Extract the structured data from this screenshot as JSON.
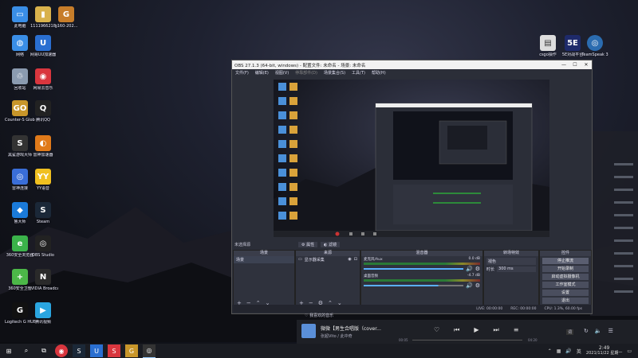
{
  "desktop_icons": [
    {
      "label": "此电脑",
      "icon": "computer-icon",
      "color": "#3a8ee6",
      "glyph": "▭"
    },
    {
      "label": "1111966218",
      "icon": "folder-icon",
      "color": "#d9b24c",
      "glyph": "▮"
    },
    {
      "label": "g160-202...",
      "icon": "csgo-icon",
      "color": "#c77d2a",
      "glyph": "G"
    },
    {
      "label": "网络",
      "icon": "network-icon",
      "color": "#3a8ee6",
      "glyph": "◍"
    },
    {
      "label": "网易UU加速器",
      "icon": "uu-icon",
      "color": "#2a6fd1",
      "glyph": "U"
    },
    {
      "label": "回收站",
      "icon": "recycle-bin-icon",
      "color": "#8b9bb0",
      "glyph": "♲"
    },
    {
      "label": "网易云音乐",
      "icon": "netease-music-icon",
      "color": "#d9363e",
      "glyph": "◉"
    },
    {
      "label": "Counter-S Global Off...",
      "icon": "csgo-icon",
      "color": "#c8962a",
      "glyph": "GO"
    },
    {
      "label": "腾讯QQ",
      "icon": "qq-icon",
      "color": "#222",
      "glyph": "Q"
    },
    {
      "label": "黑鲨游戏大师",
      "icon": "blackshark-icon",
      "color": "#333",
      "glyph": "S"
    },
    {
      "label": "雷神加速器",
      "icon": "leishen-icon",
      "color": "#e07a1a",
      "glyph": "◐"
    },
    {
      "label": "雷神连接",
      "icon": "leishen-link-icon",
      "color": "#3a6ed8",
      "glyph": "◎"
    },
    {
      "label": "YY语音",
      "icon": "yy-icon",
      "color": "#f0c020",
      "glyph": "YY"
    },
    {
      "label": "鲁大师",
      "icon": "ludashi-icon",
      "color": "#1a7ad9",
      "glyph": "◆"
    },
    {
      "label": "Steam",
      "icon": "steam-icon",
      "color": "#1b2838",
      "glyph": "S"
    },
    {
      "label": "360安全浏览器",
      "icon": "360-browser-icon",
      "color": "#3bb34a",
      "glyph": "e"
    },
    {
      "label": "OBS Studio",
      "icon": "obs-icon",
      "color": "#222",
      "glyph": "◎"
    },
    {
      "label": "360安全卫士",
      "icon": "360-guard-icon",
      "color": "#4cb848",
      "glyph": "+"
    },
    {
      "label": "NVIDIA Broadcast",
      "icon": "nvidia-icon",
      "color": "#2a2a2a",
      "glyph": "N"
    },
    {
      "label": "Logitech G HUB",
      "icon": "logitech-icon",
      "color": "#111",
      "glyph": "G"
    },
    {
      "label": "腾讯视频",
      "icon": "tencent-video-icon",
      "color": "#2aa5e0",
      "glyph": "▶"
    }
  ],
  "right_icons": [
    {
      "label": "csgo操作",
      "icon": "document-icon"
    },
    {
      "label": "5E对战平台",
      "icon": "5e-icon"
    },
    {
      "label": "TeamSpeak 3",
      "icon": "teamspeak-icon"
    }
  ],
  "obs": {
    "title": "OBS 27.1.3 (64-bit, windows) - 配置文件: 未命名 - 场景: 未命名",
    "menu": [
      "文件(F)",
      "编辑(E)",
      "视图(V)",
      "停靠部件(D)",
      "场景集合(S)",
      "工具(T)",
      "帮助(H)"
    ],
    "no_source": "未选择源",
    "props_btn": "属性",
    "filters_btn": "滤镜",
    "docks": {
      "scenes": {
        "title": "场景",
        "item": "场景"
      },
      "sources": {
        "title": "来源",
        "item": "显示器采集"
      },
      "mixer": {
        "title": "混音器",
        "tracks": [
          {
            "name": "麦克风/Aux",
            "db": "0.0 dB"
          },
          {
            "name": "桌面音频",
            "db": "-4.7 dB"
          }
        ]
      },
      "transitions": {
        "title": "转场特效",
        "type": "褪色",
        "duration_label": "时长",
        "duration": "300 ms"
      },
      "controls": {
        "title": "控件",
        "buttons": [
          "停止推流",
          "开始录制",
          "启动虚拟摄像机",
          "工作室模式",
          "设置",
          "退出"
        ]
      }
    },
    "status": {
      "live": "LIVE: 00:00:00",
      "rec": "REC: 00:00:00",
      "cpu": "CPU: 1.3%, 60.00 fps"
    }
  },
  "player": {
    "song": "微微【男生合唱版（cover...",
    "artist": "张超Vito / 此中奇",
    "lyrics_btn": "词",
    "time_current": "00:05",
    "time_total": "04:20",
    "playlist_hint": "我喜欢的音乐"
  },
  "taskbar": {
    "time": "2:49",
    "date": "2021/11/22 星期一",
    "ime": "英"
  }
}
